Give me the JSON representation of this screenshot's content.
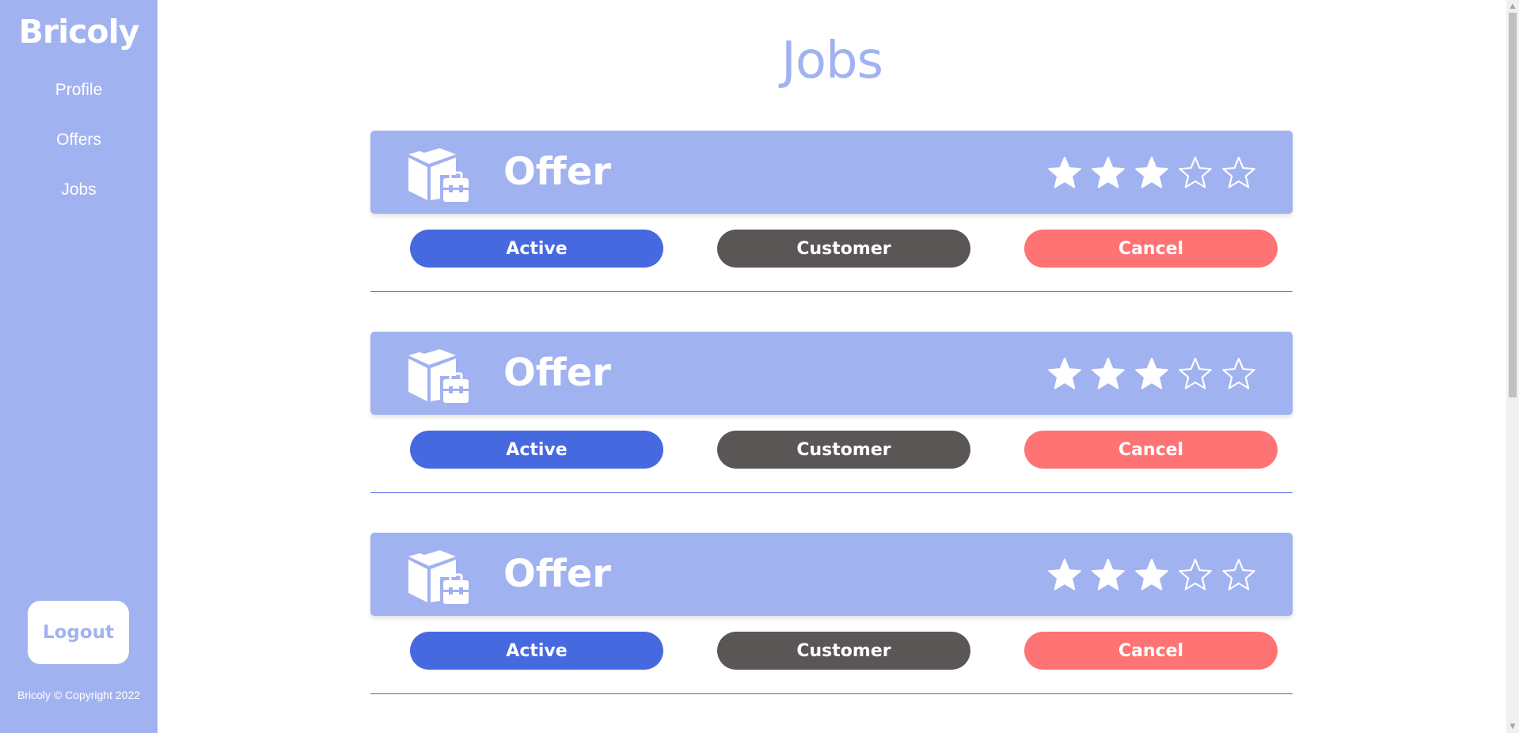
{
  "sidebar": {
    "brand": "Bricoly",
    "items": [
      {
        "label": "Profile"
      },
      {
        "label": "Offers"
      },
      {
        "label": "Jobs"
      }
    ],
    "logout_label": "Logout",
    "copyright": "Bricoly © Copyright 2022"
  },
  "main": {
    "title": "Jobs",
    "jobs": [
      {
        "label": "Offer",
        "rating": 3,
        "rating_max": 5,
        "icon": "package-toolbox-icon",
        "actions": {
          "active": "Active",
          "customer": "Customer",
          "cancel": "Cancel"
        }
      },
      {
        "label": "Offer",
        "rating": 3,
        "rating_max": 5,
        "icon": "package-toolbox-icon",
        "actions": {
          "active": "Active",
          "customer": "Customer",
          "cancel": "Cancel"
        }
      },
      {
        "label": "Offer",
        "rating": 3,
        "rating_max": 5,
        "icon": "package-toolbox-icon",
        "actions": {
          "active": "Active",
          "customer": "Customer",
          "cancel": "Cancel"
        }
      }
    ]
  },
  "colors": {
    "brand": "#a1b2f0",
    "active": "#4769e0",
    "customer": "#5b5656",
    "cancel": "#fe7374",
    "text_on_brand": "#ffffff"
  }
}
